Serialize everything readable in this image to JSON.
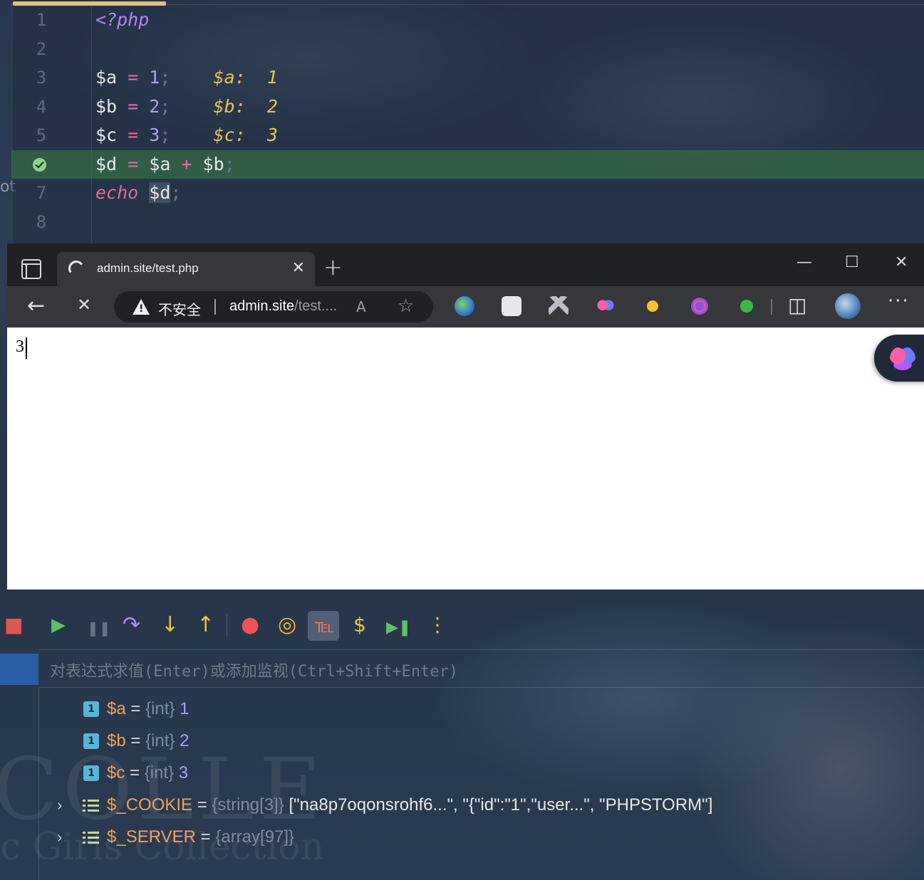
{
  "editor": {
    "lines": [
      {
        "num": "1",
        "tokens": [
          {
            "t": "<?php",
            "c": "tok-php"
          }
        ]
      },
      {
        "num": "2",
        "tokens": []
      },
      {
        "num": "3",
        "tokens": [
          {
            "t": "$a",
            "c": "tok-var"
          },
          {
            "t": " = ",
            "c": "tok-op"
          },
          {
            "t": "1",
            "c": "tok-num"
          },
          {
            "t": ";",
            "c": "tok-semi"
          },
          {
            "t": "    $a:  1",
            "c": "tok-inline"
          }
        ]
      },
      {
        "num": "4",
        "tokens": [
          {
            "t": "$b",
            "c": "tok-var"
          },
          {
            "t": " = ",
            "c": "tok-op"
          },
          {
            "t": "2",
            "c": "tok-num"
          },
          {
            "t": ";",
            "c": "tok-semi"
          },
          {
            "t": "    $b:  2",
            "c": "tok-inline"
          }
        ]
      },
      {
        "num": "5",
        "tokens": [
          {
            "t": "$c",
            "c": "tok-var"
          },
          {
            "t": " = ",
            "c": "tok-op"
          },
          {
            "t": "3",
            "c": "tok-num"
          },
          {
            "t": ";",
            "c": "tok-semi"
          },
          {
            "t": "    $c:  3",
            "c": "tok-inline"
          }
        ]
      },
      {
        "num": "",
        "exec": true,
        "tokens": [
          {
            "t": "$d",
            "c": "tok-var"
          },
          {
            "t": " = ",
            "c": "tok-op"
          },
          {
            "t": "$a",
            "c": "tok-var"
          },
          {
            "t": " + ",
            "c": "tok-op"
          },
          {
            "t": "$b",
            "c": "tok-var"
          },
          {
            "t": ";",
            "c": "tok-semi"
          }
        ]
      },
      {
        "num": "7",
        "tokens": [
          {
            "t": "echo",
            "c": "tok-kw"
          },
          {
            "t": " ",
            "c": "tok-var"
          },
          {
            "t": "$d",
            "c": "tok-var tok-hl"
          },
          {
            "t": ";",
            "c": "tok-semi"
          }
        ]
      },
      {
        "num": "8",
        "tokens": []
      }
    ],
    "side_text": "ot"
  },
  "browser": {
    "tab_title": "admin.site/test.php",
    "tab_close": "✕",
    "new_tab": "+",
    "minimize": "—",
    "maximize": "☐",
    "close": "✕",
    "back": "←",
    "stop": "✕",
    "insecure_label": "不安全",
    "url_host": "admin.site",
    "url_path": "/test....",
    "read_aloud": "A",
    "favorite": "☆",
    "more": "···",
    "output": "3",
    "split_screen": "◫"
  },
  "debugger": {
    "eval_placeholder": "对表达式求值(Enter)或添加监视(Ctrl+Shift+Enter)",
    "icons": {
      "stop": "■",
      "resume": "▶",
      "pause": "❚❚",
      "step_over": "↷",
      "step_into": "↓",
      "step_out": "↑",
      "breakpoints": "●",
      "mute": "◎",
      "xdebug": "℡",
      "dollar": "$",
      "run_to_cursor": "▶❚",
      "more": "⋮"
    },
    "variables": [
      {
        "expandable": false,
        "icon": "int",
        "name": "$a",
        "type": "{int}",
        "value": "1"
      },
      {
        "expandable": false,
        "icon": "int",
        "name": "$b",
        "type": "{int}",
        "value": "2"
      },
      {
        "expandable": false,
        "icon": "int",
        "name": "$c",
        "type": "{int}",
        "value": "3"
      },
      {
        "expandable": true,
        "icon": "array",
        "name": "$_COOKIE",
        "type": "{string[3]}",
        "value": "[\"na8p7oqonsrohf6...\", \"{\"id\":\"1\",\"user...\", \"PHPSTORM\"]"
      },
      {
        "expandable": true,
        "icon": "array",
        "name": "$_SERVER",
        "type": "{array[97]}",
        "value": ""
      }
    ],
    "int_icon_label": "1",
    "expand_glyph": "›"
  },
  "background": {
    "brand_text": "COLLE",
    "brand_sub": "c Girls Collection"
  },
  "colors": {
    "exec_line": "#3a8046",
    "accent_tab": "#e5c07b",
    "var_name": "#f0a060",
    "value_purple": "#a99ff7"
  }
}
